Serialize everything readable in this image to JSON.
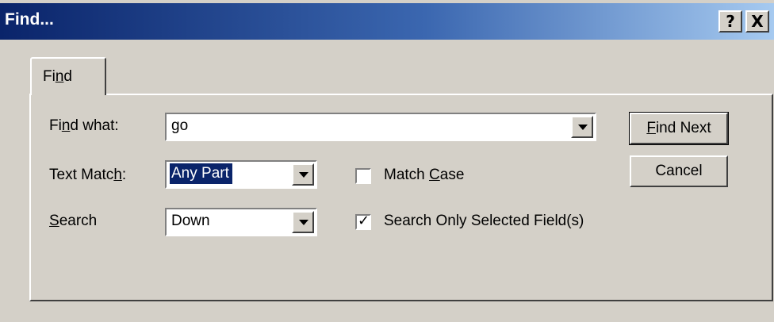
{
  "window": {
    "title": "Find...",
    "help_label": "?",
    "close_label": "X"
  },
  "tab": {
    "pre": "Fi",
    "key": "n",
    "post": "d"
  },
  "find_what": {
    "label_pre": "Fi",
    "label_key": "n",
    "label_post": "d what:",
    "value": "go"
  },
  "text_match": {
    "label_pre": "Text Matc",
    "label_key": "h",
    "label_post": ":",
    "value": "Any Part"
  },
  "search": {
    "label_key": "S",
    "label_post": "earch",
    "value": "Down"
  },
  "match_case": {
    "pre": "Match ",
    "key": "C",
    "post": "ase",
    "checked": false
  },
  "selected_fields": {
    "label": "Search Only Selected Field(s)",
    "checked": true,
    "check_glyph": "✓"
  },
  "buttons": {
    "find_next_key": "F",
    "find_next_post": "ind Next",
    "cancel": "Cancel"
  },
  "colors": {
    "face": "#d4d0c8",
    "title_start": "#0a246a",
    "title_end": "#a6caf0",
    "selection": "#0a246a"
  }
}
